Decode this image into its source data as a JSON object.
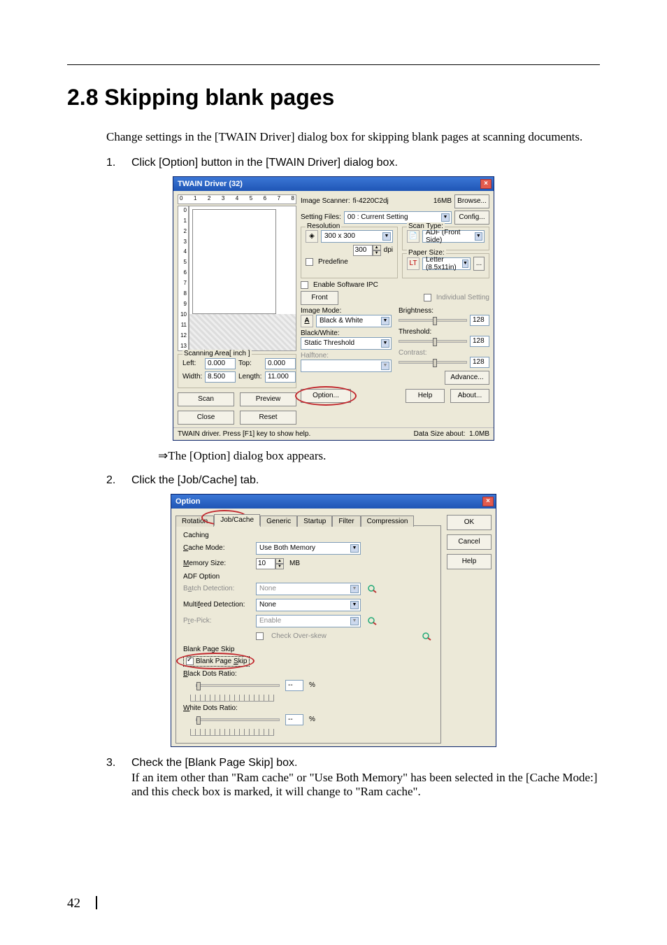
{
  "page": {
    "number": "42"
  },
  "heading": "2.8   Skipping blank pages",
  "intro": "Change settings in the [TWAIN Driver] dialog box for skipping blank pages at scanning documents.",
  "steps": {
    "s1": {
      "num": "1.",
      "text": "Click [Option] button in the [TWAIN Driver] dialog box."
    },
    "arrow": "⇒The [Option] dialog box appears.",
    "s2": {
      "num": "2.",
      "text": "Click the [Job/Cache] tab."
    },
    "s3": {
      "num": "3.",
      "line1": "Check the [Blank Page Skip] box.",
      "line2": "If an item other than \"Ram cache\" or \"Use Both Memory\" has been selected in the [Cache Mode:] and this check box is marked, it will change to \"Ram cache\"."
    }
  },
  "twain": {
    "title": "TWAIN Driver (32)",
    "ruler_h": [
      "0",
      "1",
      "2",
      "3",
      "4",
      "5",
      "6",
      "7",
      "8"
    ],
    "ruler_v": [
      "0",
      "1",
      "2",
      "3",
      "4",
      "5",
      "6",
      "7",
      "8",
      "9",
      "10",
      "11",
      "12",
      "13"
    ],
    "scanArea": {
      "legend": "Scanning Area[ inch ]",
      "left_l": "Left:",
      "left_v": "0.000",
      "top_l": "Top:",
      "top_v": "0.000",
      "width_l": "Width:",
      "width_v": "8.500",
      "length_l": "Length:",
      "length_v": "11.000"
    },
    "btns": {
      "scan": "Scan",
      "preview": "Preview",
      "close": "Close",
      "reset": "Reset",
      "option": "Option...",
      "help": "Help",
      "about": "About...",
      "advance": "Advance...",
      "browse": "Browse...",
      "config": "Config...",
      "ellipsis": "..."
    },
    "right": {
      "imgscanner_l": "Image Scanner:",
      "imgscanner_v": "fi-4220C2dj",
      "mem": "16MB",
      "setfiles_l": "Setting Files:",
      "setfiles_v": "00 : Current Setting",
      "reso_legend": "Resolution",
      "reso_val": "300 x 300",
      "dpi_in": "300",
      "dpi_l": "dpi",
      "predefine": "Predefine",
      "enableipc": "Enable Software IPC",
      "front_l": "Front",
      "indiv": "Individual Setting",
      "scantype_legend": "Scan Type:",
      "scantype_v": "ADF (Front Side)",
      "papersize_legend": "Paper Size:",
      "papersize_v": "Letter (8.5x11in)",
      "imagemode_l": "Image Mode:",
      "imagemode_v": "Black & White",
      "bw_l": "Black/White:",
      "bw_v": "Static Threshold",
      "halftone_l": "Halftone:",
      "brightness_l": "Brightness:",
      "brightness_v": "128",
      "threshold_l": "Threshold:",
      "threshold_v": "128",
      "contrast_l": "Contrast:",
      "contrast_v": "128"
    },
    "status": {
      "left": "TWAIN driver. Press [F1] key to show help.",
      "right_l": "Data Size about:",
      "right_v": "1.0MB"
    }
  },
  "option": {
    "title": "Option",
    "tabs": [
      "Rotation",
      "Job/Cache",
      "Generic",
      "Startup",
      "Filter",
      "Compression"
    ],
    "btns": {
      "ok": "OK",
      "cancel": "Cancel",
      "help": "Help"
    },
    "caching_legend": "Caching",
    "cache_mode_l": "Cache Mode:",
    "cache_mode_v": "Use Both Memory",
    "memory_l": "Memory Size:",
    "memory_v": "10",
    "memory_unit": "MB",
    "adf_legend": "ADF Option",
    "batch_l": "Batch Detection:",
    "batch_v": "None",
    "multi_l": "Multifeed Detection:",
    "multi_v": "None",
    "prepick_l": "Pre-Pick:",
    "prepick_v": "Enable",
    "overskew": "Check Over-skew",
    "blank_legend": "Blank Page Skip",
    "blank_chk": "Blank Page Skip",
    "black_l": "Black Dots Ratio:",
    "black_v": "--",
    "unit": "%",
    "white_l": "White Dots Ratio:",
    "white_v": "--"
  }
}
